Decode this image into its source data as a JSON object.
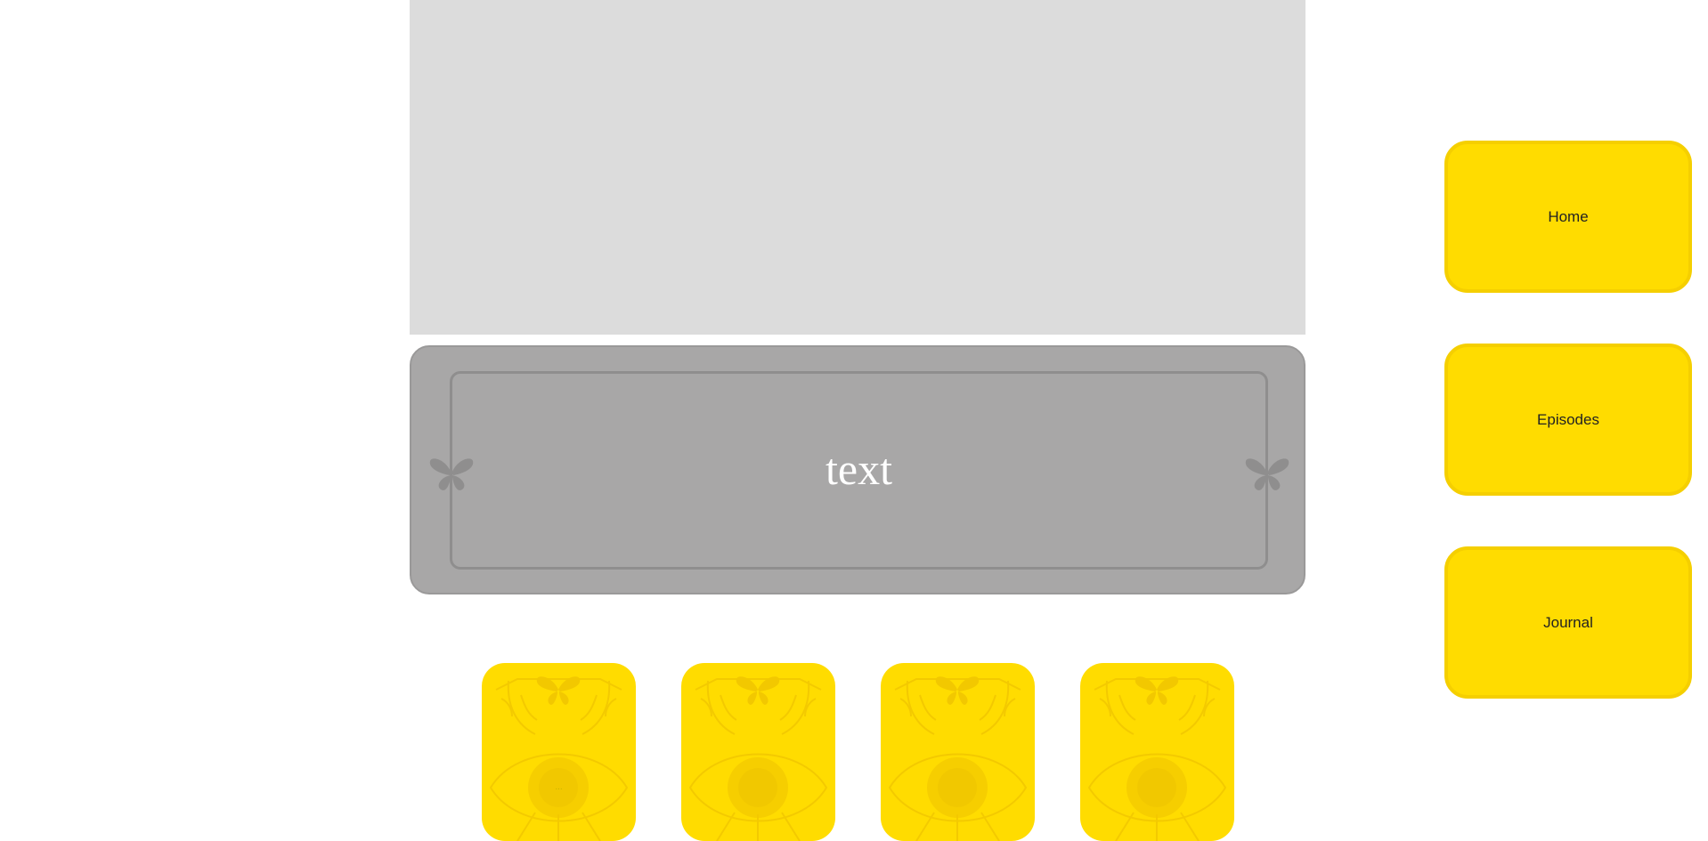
{
  "hero": {
    "color": "#dcdcdc"
  },
  "text_panel": {
    "text": "text",
    "icons": [
      "butterfly-icon",
      "butterfly-icon"
    ]
  },
  "nav": {
    "items": [
      {
        "label": "Home"
      },
      {
        "label": "Episodes"
      },
      {
        "label": "Journal"
      }
    ]
  },
  "cards": [
    {
      "caption": "...",
      "icon": "stag-eye-butterfly-emblem"
    },
    {
      "caption": "",
      "icon": "stag-eye-butterfly-emblem"
    },
    {
      "caption": "",
      "icon": "stag-eye-butterfly-emblem"
    },
    {
      "caption": "",
      "icon": "stag-eye-butterfly-emblem"
    }
  ],
  "colors": {
    "accent": "#ffdc00",
    "panel": "#a8a7a7",
    "background": "#ffffff"
  }
}
